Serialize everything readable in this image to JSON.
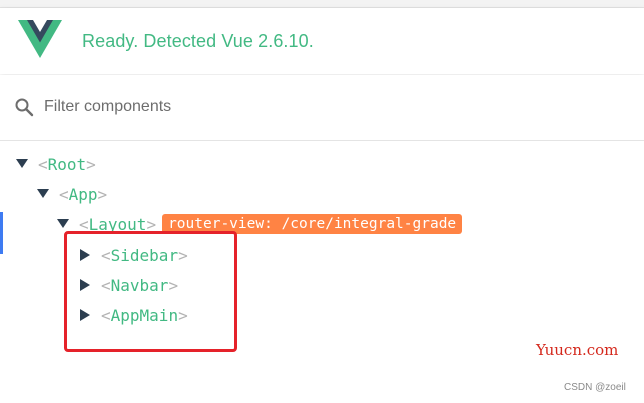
{
  "header": {
    "status_text": "Ready. Detected Vue 2.6.10.",
    "logo_icon": "vue-logo-icon",
    "brand_green": "#42b983",
    "brand_dark": "#35495e"
  },
  "filter": {
    "placeholder": "Filter components",
    "value": "",
    "icon": "search-icon"
  },
  "tree": {
    "bracket_open": "<",
    "bracket_close": ">",
    "nodes": [
      {
        "name": "Root",
        "expanded": true
      },
      {
        "name": "App",
        "expanded": true
      },
      {
        "name": "Layout",
        "expanded": true,
        "badge": "router-view: /core/integral-grade"
      },
      {
        "name": "Sidebar",
        "expanded": false
      },
      {
        "name": "Navbar",
        "expanded": false
      },
      {
        "name": "AppMain",
        "expanded": false
      }
    ],
    "badge_color": "#ff8344"
  },
  "watermarks": {
    "site": "Yuucn.com",
    "author": "CSDN @zoeil"
  }
}
